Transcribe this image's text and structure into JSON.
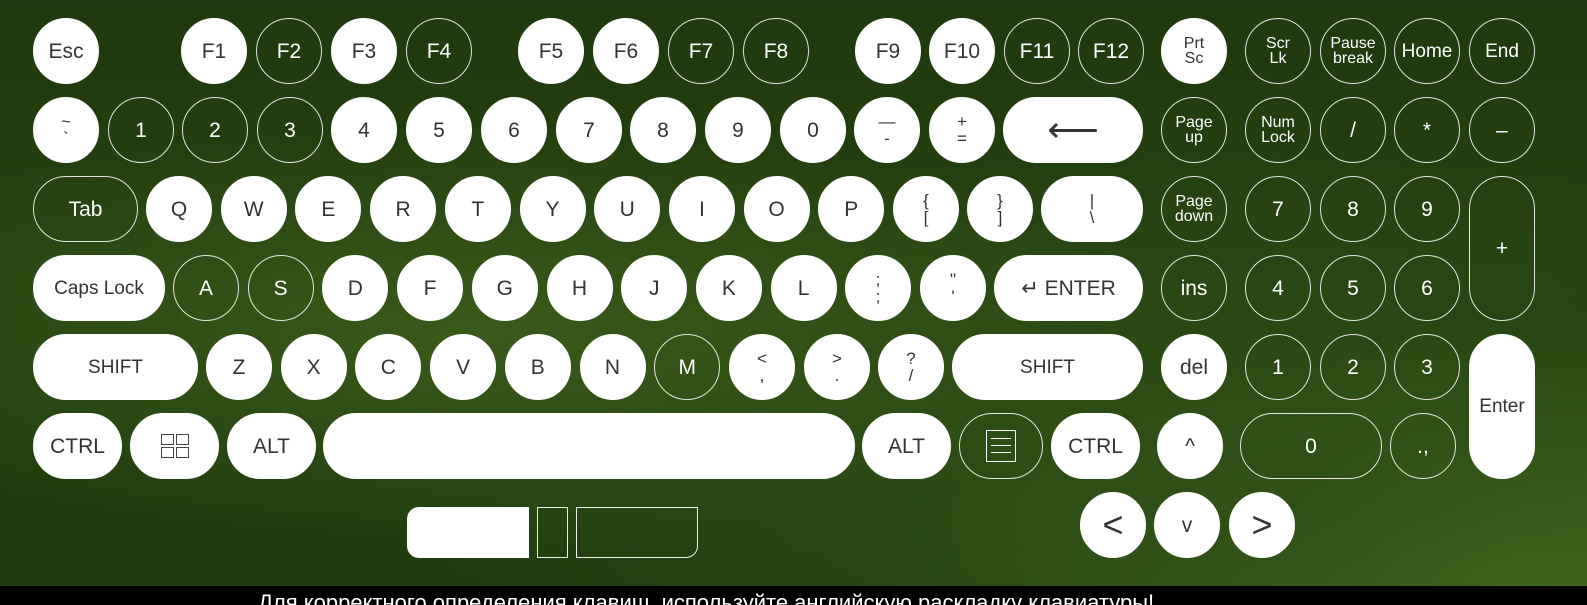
{
  "keyboard": {
    "colors": {
      "key_fill": "#ffffff",
      "key_outline": "#ffffff",
      "background": "#25420f"
    },
    "keys": [
      {
        "label": "Esc",
        "style": "w",
        "icon": ""
      },
      {
        "label": "F1",
        "style": "w",
        "icon": ""
      },
      {
        "label": "F2",
        "style": "o",
        "icon": ""
      },
      {
        "label": "F3",
        "style": "w",
        "icon": ""
      },
      {
        "label": "F4",
        "style": "o",
        "icon": ""
      },
      {
        "label": "F5",
        "style": "w",
        "icon": ""
      },
      {
        "label": "F6",
        "style": "w",
        "icon": ""
      },
      {
        "label": "F7",
        "style": "o",
        "icon": ""
      },
      {
        "label": "F8",
        "style": "o",
        "icon": ""
      },
      {
        "label": "F9",
        "style": "w",
        "icon": ""
      },
      {
        "label": "F10",
        "style": "w",
        "icon": ""
      },
      {
        "label": "F11",
        "style": "o",
        "icon": ""
      },
      {
        "label": "F12",
        "style": "o",
        "icon": ""
      },
      {
        "label": "Prt\nSc",
        "style": "w",
        "icon": ""
      },
      {
        "label": "Scr\nLk",
        "style": "o",
        "icon": ""
      },
      {
        "label": "Pause\nbreak",
        "style": "o",
        "icon": ""
      },
      {
        "label": "Home",
        "style": "o",
        "icon": ""
      },
      {
        "label": "End",
        "style": "o",
        "icon": ""
      },
      {
        "label": "~\n`",
        "style": "w",
        "icon": ""
      },
      {
        "label": "1",
        "style": "o",
        "icon": ""
      },
      {
        "label": "2",
        "style": "o",
        "icon": ""
      },
      {
        "label": "3",
        "style": "o",
        "icon": ""
      },
      {
        "label": "4",
        "style": "w",
        "icon": ""
      },
      {
        "label": "5",
        "style": "w",
        "icon": ""
      },
      {
        "label": "6",
        "style": "w",
        "icon": ""
      },
      {
        "label": "7",
        "style": "w",
        "icon": ""
      },
      {
        "label": "8",
        "style": "w",
        "icon": ""
      },
      {
        "label": "9",
        "style": "w",
        "icon": ""
      },
      {
        "label": "0",
        "style": "w",
        "icon": ""
      },
      {
        "label": "—\n-",
        "style": "w",
        "icon": ""
      },
      {
        "label": "+\n=",
        "style": "w",
        "icon": ""
      },
      {
        "label": "⟵",
        "style": "w",
        "icon": "backspace-arrow-icon"
      },
      {
        "label": "Page\nup",
        "style": "o",
        "icon": ""
      },
      {
        "label": "Num\nLock",
        "style": "o",
        "icon": ""
      },
      {
        "label": "/",
        "style": "o",
        "icon": ""
      },
      {
        "label": "*",
        "style": "o",
        "icon": ""
      },
      {
        "label": "–",
        "style": "o",
        "icon": ""
      },
      {
        "label": "Tab",
        "style": "o",
        "icon": ""
      },
      {
        "label": "Q",
        "style": "w",
        "icon": ""
      },
      {
        "label": "W",
        "style": "w",
        "icon": ""
      },
      {
        "label": "E",
        "style": "w",
        "icon": ""
      },
      {
        "label": "R",
        "style": "w",
        "icon": ""
      },
      {
        "label": "T",
        "style": "w",
        "icon": ""
      },
      {
        "label": "Y",
        "style": "w",
        "icon": ""
      },
      {
        "label": "U",
        "style": "w",
        "icon": ""
      },
      {
        "label": "I",
        "style": "w",
        "icon": ""
      },
      {
        "label": "O",
        "style": "w",
        "icon": ""
      },
      {
        "label": "P",
        "style": "w",
        "icon": ""
      },
      {
        "label": "{\n[",
        "style": "w",
        "icon": ""
      },
      {
        "label": "}\n]",
        "style": "w",
        "icon": ""
      },
      {
        "label": "|\n\\",
        "style": "w",
        "icon": ""
      },
      {
        "label": "Page\ndown",
        "style": "o",
        "icon": ""
      },
      {
        "label": "7",
        "style": "o",
        "icon": ""
      },
      {
        "label": "8",
        "style": "o",
        "icon": ""
      },
      {
        "label": "9",
        "style": "o",
        "icon": ""
      },
      {
        "label": "+",
        "style": "o",
        "icon": ""
      },
      {
        "label": "Caps Lock",
        "style": "w",
        "icon": ""
      },
      {
        "label": "A",
        "style": "o",
        "icon": ""
      },
      {
        "label": "S",
        "style": "o",
        "icon": ""
      },
      {
        "label": "D",
        "style": "w",
        "icon": ""
      },
      {
        "label": "F",
        "style": "w",
        "icon": ""
      },
      {
        "label": "G",
        "style": "w",
        "icon": ""
      },
      {
        "label": "H",
        "style": "w",
        "icon": ""
      },
      {
        "label": "J",
        "style": "w",
        "icon": ""
      },
      {
        "label": "K",
        "style": "w",
        "icon": ""
      },
      {
        "label": "L",
        "style": "w",
        "icon": ""
      },
      {
        "label": ";\n;",
        "style": "w",
        "icon": ""
      },
      {
        "label": "\"\n'",
        "style": "w",
        "icon": ""
      },
      {
        "label": "↵ ENTER",
        "style": "w",
        "icon": "enter-arrow-icon"
      },
      {
        "label": "ins",
        "style": "o",
        "icon": ""
      },
      {
        "label": "4",
        "style": "o",
        "icon": ""
      },
      {
        "label": "5",
        "style": "o",
        "icon": ""
      },
      {
        "label": "6",
        "style": "o",
        "icon": ""
      },
      {
        "label": "SHIFT",
        "style": "w",
        "icon": ""
      },
      {
        "label": "Z",
        "style": "w",
        "icon": ""
      },
      {
        "label": "X",
        "style": "w",
        "icon": ""
      },
      {
        "label": "C",
        "style": "w",
        "icon": ""
      },
      {
        "label": "V",
        "style": "w",
        "icon": ""
      },
      {
        "label": "B",
        "style": "w",
        "icon": ""
      },
      {
        "label": "N",
        "style": "w",
        "icon": ""
      },
      {
        "label": "M",
        "style": "o",
        "icon": ""
      },
      {
        "label": "<\n,",
        "style": "w",
        "icon": ""
      },
      {
        "label": ">\n.",
        "style": "w",
        "icon": ""
      },
      {
        "label": "?\n/",
        "style": "w",
        "icon": ""
      },
      {
        "label": "SHIFT",
        "style": "w",
        "icon": ""
      },
      {
        "label": "del",
        "style": "w",
        "icon": ""
      },
      {
        "label": "1",
        "style": "o",
        "icon": ""
      },
      {
        "label": "2",
        "style": "o",
        "icon": ""
      },
      {
        "label": "3",
        "style": "o",
        "icon": ""
      },
      {
        "label": "Enter",
        "style": "w",
        "icon": ""
      },
      {
        "label": "CTRL",
        "style": "w",
        "icon": ""
      },
      {
        "label": "",
        "style": "w",
        "icon": "windows-logo-icon"
      },
      {
        "label": "ALT",
        "style": "w",
        "icon": ""
      },
      {
        "label": "",
        "style": "w",
        "icon": "space-bar"
      },
      {
        "label": "ALT",
        "style": "w",
        "icon": ""
      },
      {
        "label": "",
        "style": "o",
        "icon": "context-menu-icon"
      },
      {
        "label": "CTRL",
        "style": "w",
        "icon": ""
      },
      {
        "label": "^",
        "style": "w",
        "icon": ""
      },
      {
        "label": "0",
        "style": "o",
        "icon": ""
      },
      {
        "label": ".,",
        "style": "o",
        "icon": ""
      },
      {
        "label": "<",
        "style": "w",
        "icon": ""
      },
      {
        "label": "v",
        "style": "w",
        "icon": ""
      },
      {
        "label": ">",
        "style": "w",
        "icon": ""
      }
    ]
  },
  "footer": {
    "text": "Для корректного определения клавиш, используйте английскую раскладку клавиатуры!"
  }
}
